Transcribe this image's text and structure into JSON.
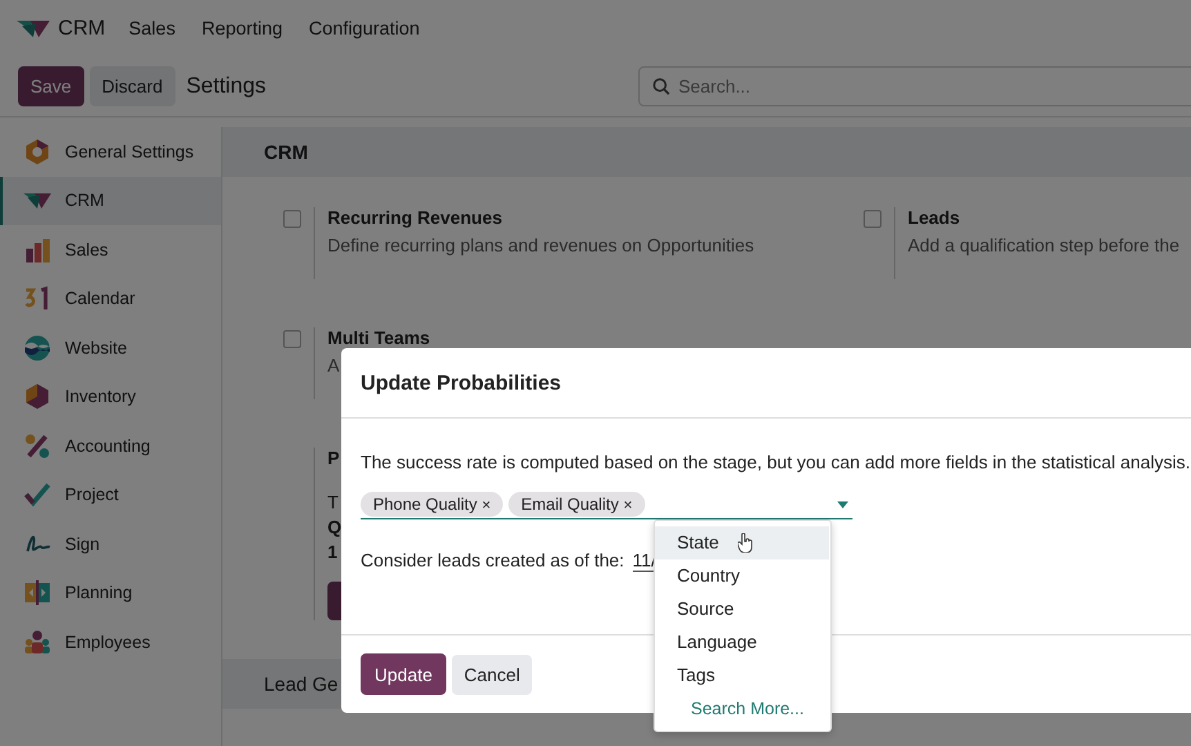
{
  "navbar": {
    "app": "CRM",
    "menu": [
      "Sales",
      "Reporting",
      "Configuration"
    ]
  },
  "control_bar": {
    "buttons": [
      {
        "label": "Save",
        "kind": "primary"
      },
      {
        "label": "Discard",
        "kind": "secondary"
      }
    ],
    "title": "Settings",
    "search": {
      "placeholder": "Search..."
    }
  },
  "sidebar": {
    "items": [
      {
        "label": "General Settings",
        "kind": "general",
        "selected": false
      },
      {
        "label": "CRM",
        "kind": "crm",
        "selected": true
      },
      {
        "label": "Sales",
        "kind": "sales",
        "selected": false
      },
      {
        "label": "Calendar",
        "kind": "calendar",
        "selected": false
      },
      {
        "label": "Website",
        "kind": "website",
        "selected": false
      },
      {
        "label": "Inventory",
        "kind": "inventory",
        "selected": false
      },
      {
        "label": "Accounting",
        "kind": "accounting",
        "selected": false
      },
      {
        "label": "Project",
        "kind": "project",
        "selected": false
      },
      {
        "label": "Sign",
        "kind": "sign",
        "selected": false
      },
      {
        "label": "Planning",
        "kind": "planning",
        "selected": false
      },
      {
        "label": "Employees",
        "kind": "employees",
        "selected": false
      }
    ]
  },
  "content": {
    "section": "CRM",
    "settings": [
      {
        "title": "Recurring Revenues",
        "description": "Define recurring plans and revenues on Opportunities",
        "checked": false
      },
      {
        "title": "Leads",
        "description": "Add a qualification step before the",
        "checked": false
      },
      {
        "title": "Multi Teams",
        "description": "A",
        "checked": false
      }
    ],
    "predictive": {
      "title": "P",
      "lines": [
        "T",
        "Q",
        "1"
      ]
    },
    "next_section": "Lead Ge"
  },
  "modal": {
    "title": "Update Probabilities",
    "text": "The success rate is computed based on the stage, but you can add more fields in the statistical analysis.",
    "tags": [
      {
        "label": "Phone Quality",
        "remove": "×"
      },
      {
        "label": "Email Quality",
        "remove": "×"
      }
    ],
    "date_label": "Consider leads created as of the:",
    "date_value": "11/",
    "buttons": [
      {
        "label": "Update",
        "kind": "primary"
      },
      {
        "label": "Cancel",
        "kind": "secondary"
      }
    ]
  },
  "dropdown": {
    "items": [
      {
        "label": "State",
        "selected": true
      },
      {
        "label": "Country",
        "selected": false
      },
      {
        "label": "Source",
        "selected": false
      },
      {
        "label": "Language",
        "selected": false
      },
      {
        "label": "Tags",
        "selected": false
      }
    ],
    "search_more": "Search More..."
  }
}
